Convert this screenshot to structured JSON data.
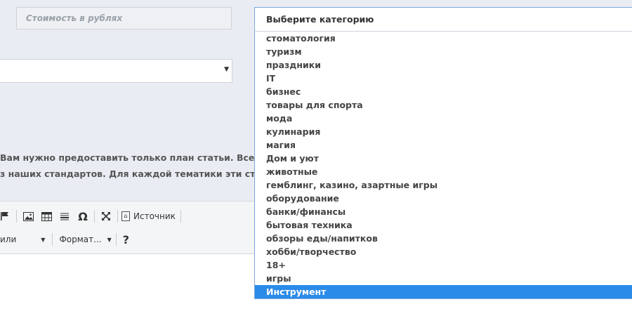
{
  "price": {
    "placeholder": "Стоимость в рублях"
  },
  "info": {
    "line1": "Вам нужно предоставить только план статьи. Все остальн",
    "line2": "з наших стандартов. Для каждой тематики эти стандарты"
  },
  "toolbar": {
    "source_label": "Источник",
    "styles_label": "или",
    "format_label": "Формат..."
  },
  "category": {
    "placeholder": "Выберите категорию",
    "options": [
      "стоматология",
      "туризм",
      "праздники",
      "IT",
      "бизнес",
      "товары для спорта",
      "мода",
      "кулинария",
      "магия",
      "Дом и уют",
      "животные",
      "гемблинг, казино, азартные игры",
      "оборудование",
      "банки/финансы",
      "бытовая техника",
      "обзоры еды/напитков",
      "хобби/творчество",
      "18+",
      "игры",
      "Инструмент"
    ],
    "selected": "Инструмент"
  }
}
